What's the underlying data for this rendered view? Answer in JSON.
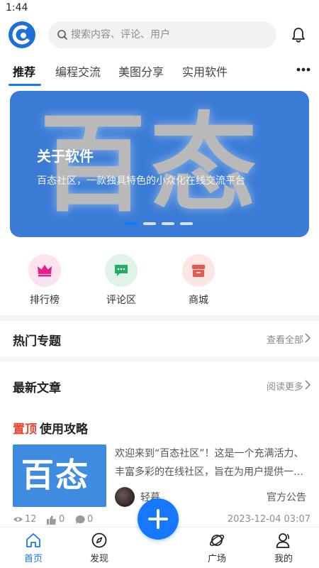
{
  "status_bar": {
    "time": "1:44"
  },
  "header": {
    "logo_icon": "community-logo-icon",
    "search_placeholder": "搜索内容、评论、用户",
    "bell_icon": "bell-icon"
  },
  "tabs": [
    {
      "label": "推荐",
      "active": true
    },
    {
      "label": "编程交流",
      "active": false
    },
    {
      "label": "美图分享",
      "active": false
    },
    {
      "label": "实用软件",
      "active": false
    }
  ],
  "banner": {
    "big_text": "百态",
    "title": "关于软件",
    "subtitle": "百态社区，一款独具特色的小众化在线交流平台",
    "slide_count": 4,
    "active_slide": 1
  },
  "quick_entries": [
    {
      "label": "排行榜",
      "icon": "crown-icon",
      "color": "#e81e8c",
      "bg": "#fde3ef"
    },
    {
      "label": "评论区",
      "icon": "comment-icon",
      "color": "#1fae62",
      "bg": "#dff3e8"
    },
    {
      "label": "商城",
      "icon": "shop-icon",
      "color": "#e8574b",
      "bg": "#fde5e3"
    }
  ],
  "hot_topics": {
    "title": "热门专题",
    "link": "查看全部"
  },
  "latest_articles": {
    "title": "最新文章",
    "link": "阅读更多"
  },
  "article": {
    "pin_tag": "置顶",
    "title": "使用攻略",
    "thumb_text": "百态",
    "excerpt": "欢迎来到“百态社区”！这是一个充满活力、丰富多彩的在线社区，旨在为用户提供一个交流分享的平台",
    "author": "轻暮",
    "category": "官方公告",
    "views": "12",
    "likes": "0",
    "comments": "0",
    "date": "2023-12-04 03:07"
  },
  "bottom_nav": [
    {
      "label": "首页",
      "icon": "home-icon",
      "active": true
    },
    {
      "label": "发现",
      "icon": "compass-icon",
      "active": false
    },
    {
      "label": "广场",
      "icon": "planet-icon",
      "active": false
    },
    {
      "label": "我的",
      "icon": "user-icon",
      "active": false
    }
  ],
  "colors": {
    "accent": "#1677ff",
    "pin": "#e5452f",
    "banner_bg": "#3a7bd5"
  }
}
